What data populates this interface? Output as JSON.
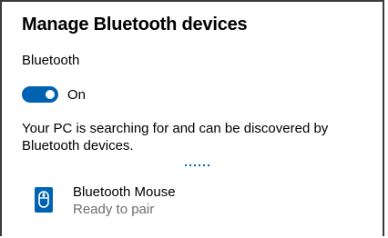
{
  "dialog": {
    "title": "Manage Bluetooth devices"
  },
  "bluetooth": {
    "label": "Bluetooth",
    "toggle_state": "On",
    "toggle_on": true,
    "status_text": "Your PC is searching for and can be discovered by Bluetooth devices."
  },
  "devices": [
    {
      "name": "Bluetooth Mouse",
      "status": "Ready to pair",
      "icon": "mouse-icon"
    }
  ],
  "colors": {
    "accent": "#0063b1",
    "secondary_text": "#6d6d6d",
    "icon_tile": "#0063b1"
  }
}
